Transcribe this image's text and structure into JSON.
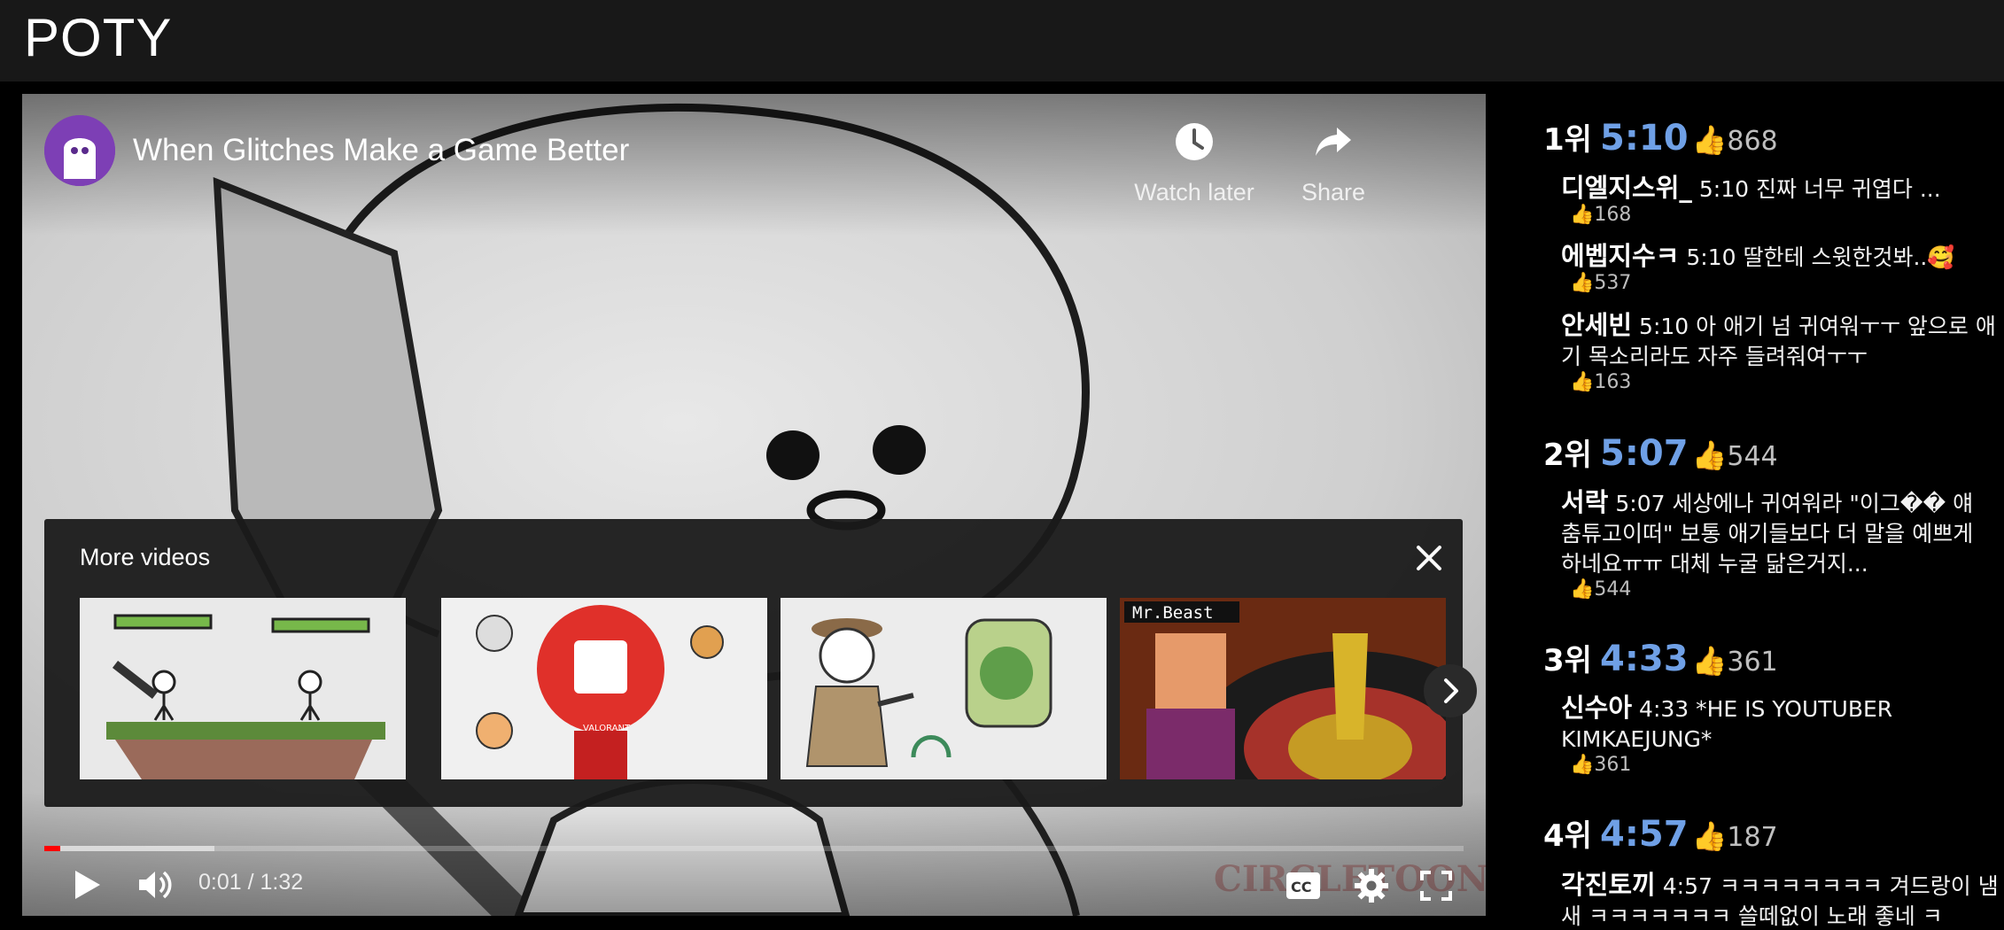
{
  "app": {
    "title": "POTY"
  },
  "video": {
    "title": "When Glitches Make a Game Better",
    "watch_later_label": "Watch later",
    "share_label": "Share",
    "more_videos_title": "More videos",
    "current_time": "0:01",
    "duration": "1:32",
    "time_separator": " / ",
    "progress_played_fraction": 0.011,
    "progress_buffered_fraction": 0.12,
    "thumb_4_badge": "Mr.Beast",
    "thumb_2_badge": "VALORANT",
    "icons": [
      "play-icon",
      "volume-icon",
      "cc-icon",
      "settings-icon",
      "fullscreen-icon",
      "clock-icon",
      "share-icon",
      "close-icon",
      "chevron-right-icon"
    ]
  },
  "ranking": [
    {
      "rank": "1위",
      "time": "5:10",
      "likes": "868",
      "comments": [
        {
          "author": "디엘지스위_",
          "text": "5:10 진짜 너무 귀엽다 ...",
          "likes": "168"
        },
        {
          "author": "에벱지수ㅋ",
          "text": "5:10 딸한테 스윗한것봐..🥰",
          "likes": "537"
        },
        {
          "author": "안세빈",
          "text": "5:10 아 애기 넘 귀여워ㅜㅜ 앞으로 애기 목소리라도 자주 들려줘여ㅜㅜ",
          "likes": "163"
        }
      ]
    },
    {
      "rank": "2위",
      "time": "5:07",
      "likes": "544",
      "comments": [
        {
          "author": "서락",
          "text": "5:07 세상에나 귀여워라 \"이그�� 얘 춤튜고이떠\" 보통 애기들보다 더 말을 예쁘게 하네요ㅠㅠ 대체 누굴 닮은거지...",
          "likes": "544"
        }
      ]
    },
    {
      "rank": "3위",
      "time": "4:33",
      "likes": "361",
      "comments": [
        {
          "author": "신수아",
          "text": "4:33 *HE IS YOUTUBER KIMKAEJUNG*",
          "likes": "361"
        }
      ]
    },
    {
      "rank": "4위",
      "time": "4:57",
      "likes": "187",
      "comments": [
        {
          "author": "각진토끼",
          "text": "4:57 ㅋㅋㅋㅋㅋㅋㅋㅋ 겨드랑이 냄새 ㅋㅋㅋㅋㅋㅋㅋ 쓸떼없이 노래 좋네 ㅋ",
          "likes": ""
        }
      ]
    }
  ],
  "like_emoji": "👍",
  "colors": {
    "accent_time": "#6fa0e6",
    "progress": "#ff0000",
    "topbar": "#181818"
  }
}
